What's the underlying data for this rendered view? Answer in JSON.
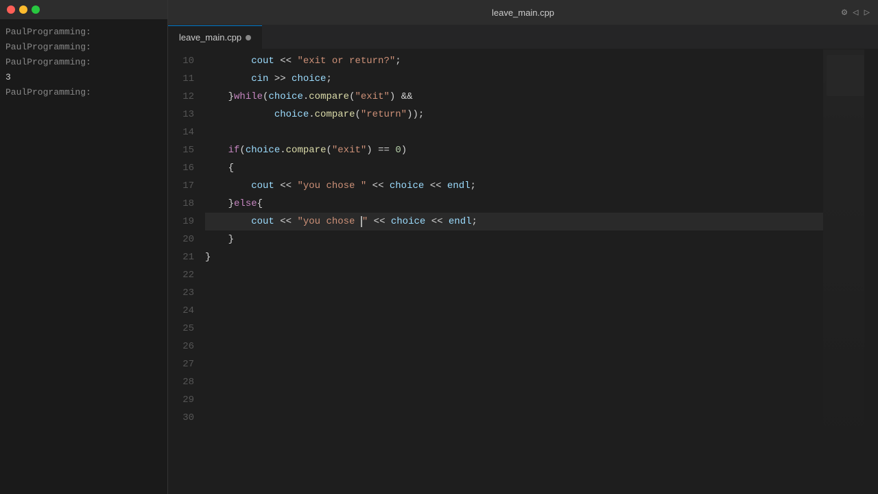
{
  "terminal": {
    "lines": [
      "PaulProgramming:",
      "PaulProgramming:",
      "PaulProgramming:",
      "3",
      "PaulProgramming:"
    ]
  },
  "editor": {
    "title": "leave_main.cpp",
    "tab_label": "leave_main.cpp",
    "tab_modified": true,
    "colors": {
      "keyword": "#c586c0",
      "string": "#ce9178",
      "variable": "#9cdcfe",
      "function": "#dcdcaa",
      "number": "#b5cea8",
      "operator": "#d4d4d4"
    },
    "line_numbers": [
      10,
      11,
      12,
      13,
      14,
      15,
      16,
      17,
      18,
      19,
      20,
      21,
      22,
      23,
      24,
      25,
      26,
      27,
      28,
      29,
      30
    ],
    "code_lines": [
      {
        "num": 10,
        "content": "        cout << \"exit or return?\";"
      },
      {
        "num": 11,
        "content": "        cin >> choice;"
      },
      {
        "num": 12,
        "content": "    }while(choice.compare(\"exit\") &&"
      },
      {
        "num": 13,
        "content": "            choice.compare(\"return\"));"
      },
      {
        "num": 14,
        "content": ""
      },
      {
        "num": 15,
        "content": "    if(choice.compare(\"exit\") == 0)"
      },
      {
        "num": 16,
        "content": "    {"
      },
      {
        "num": 17,
        "content": "        cout << \"you chose \" << choice << endl;"
      },
      {
        "num": 18,
        "content": "    }else{"
      },
      {
        "num": 19,
        "content": "        cout << \"you chose |\" << choice << endl;"
      },
      {
        "num": 20,
        "content": "    }"
      },
      {
        "num": 21,
        "content": "}"
      },
      {
        "num": 22,
        "content": ""
      },
      {
        "num": 23,
        "content": ""
      },
      {
        "num": 24,
        "content": ""
      },
      {
        "num": 25,
        "content": ""
      },
      {
        "num": 26,
        "content": ""
      },
      {
        "num": 27,
        "content": ""
      },
      {
        "num": 28,
        "content": ""
      },
      {
        "num": 29,
        "content": ""
      },
      {
        "num": 30,
        "content": ""
      }
    ]
  }
}
